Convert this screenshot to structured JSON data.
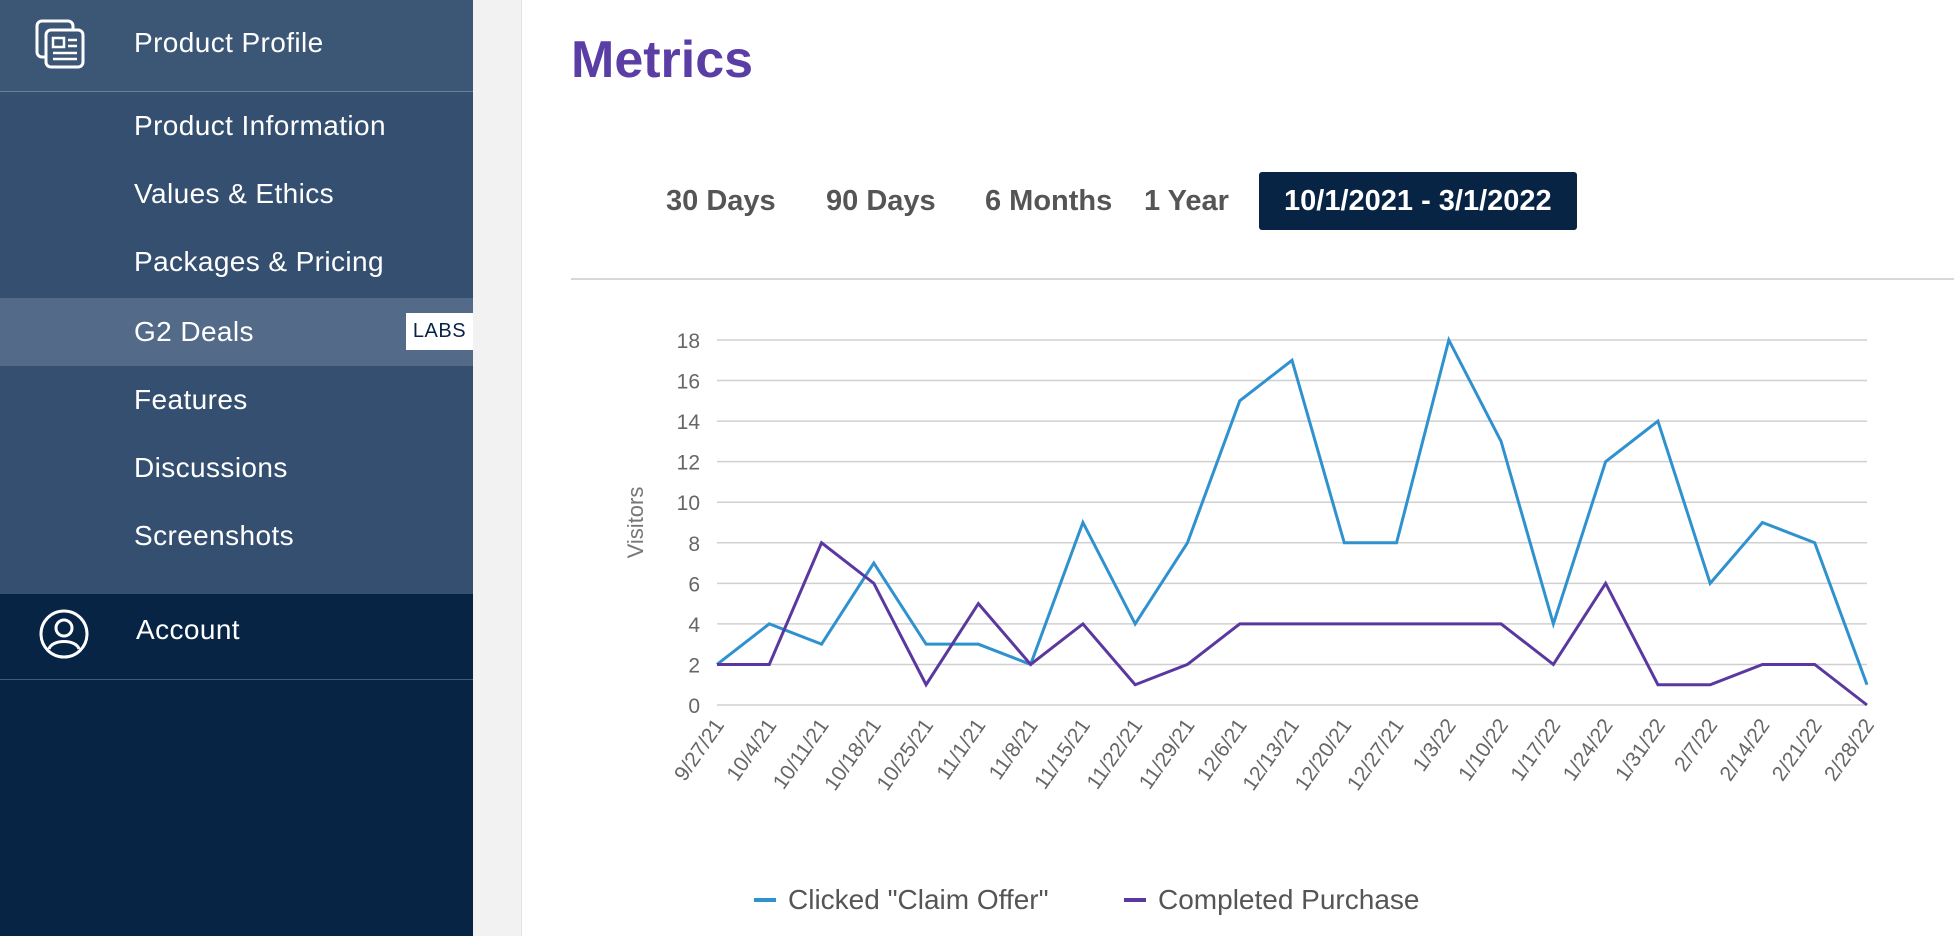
{
  "sidebar": {
    "header": {
      "label": "Product Profile",
      "icon": "product-profile-icon"
    },
    "items": [
      {
        "label": "Product Information"
      },
      {
        "label": "Values & Ethics"
      },
      {
        "label": "Packages & Pricing"
      },
      {
        "label": "G2 Deals",
        "badge": "LABS",
        "active": true
      },
      {
        "label": "Features"
      },
      {
        "label": "Discussions"
      },
      {
        "label": "Screenshots"
      }
    ],
    "account": {
      "label": "Account",
      "icon": "account-icon"
    }
  },
  "main": {
    "title": "Metrics",
    "range_tabs": [
      {
        "label": "30 Days"
      },
      {
        "label": "90 Days"
      },
      {
        "label": "6 Months"
      },
      {
        "label": "1 Year"
      },
      {
        "label": "10/1/2021 - 3/1/2022",
        "selected": true
      }
    ]
  },
  "colors": {
    "sidebar_bg": "#072444",
    "sidebar_section": "#344f70",
    "sidebar_active": "#536b89",
    "title": "#5a3ea6",
    "series_claim": "#2f92cf",
    "series_purchase": "#5b38a0"
  },
  "chart_data": {
    "type": "line",
    "title": "",
    "xlabel": "",
    "ylabel": "Visitors",
    "ylim": [
      0,
      18
    ],
    "yticks": [
      0,
      2,
      4,
      6,
      8,
      10,
      12,
      14,
      16,
      18
    ],
    "grid": true,
    "legend_position": "bottom",
    "categories": [
      "9/27/21",
      "10/4/21",
      "10/11/21",
      "10/18/21",
      "10/25/21",
      "11/1/21",
      "11/8/21",
      "11/15/21",
      "11/22/21",
      "11/29/21",
      "12/6/21",
      "12/13/21",
      "12/20/21",
      "12/27/21",
      "1/3/22",
      "1/10/22",
      "1/17/22",
      "1/24/22",
      "1/31/22",
      "2/7/22",
      "2/14/22",
      "2/21/22",
      "2/28/22"
    ],
    "series": [
      {
        "name": "Clicked \"Claim Offer\"",
        "color": "#2f92cf",
        "values": [
          2,
          4,
          3,
          7,
          3,
          3,
          2,
          9,
          4,
          8,
          15,
          17,
          8,
          8,
          18,
          13,
          4,
          12,
          14,
          6,
          9,
          8,
          1
        ]
      },
      {
        "name": "Completed Purchase",
        "color": "#5b38a0",
        "values": [
          2,
          2,
          8,
          6,
          1,
          5,
          2,
          4,
          1,
          2,
          4,
          4,
          4,
          4,
          4,
          4,
          2,
          6,
          1,
          1,
          2,
          2,
          0
        ]
      }
    ]
  }
}
